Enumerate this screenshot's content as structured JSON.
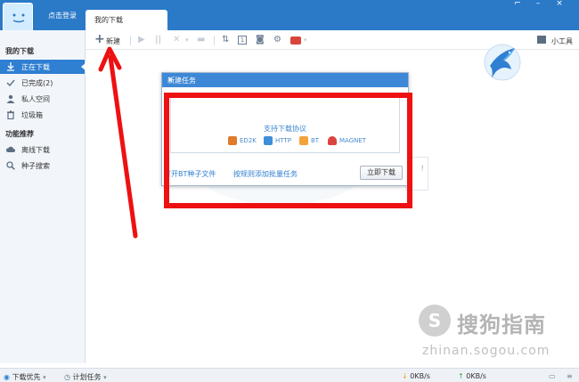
{
  "app": {
    "login_text": "点击登录",
    "tab_label": "我的下载",
    "window_controls": [
      "restore-icon",
      "minimize-icon",
      "close-icon"
    ]
  },
  "sidebar": {
    "section_my_downloads": "我的下载",
    "items": [
      {
        "label": "正在下载",
        "icon": "download-icon",
        "active": true
      },
      {
        "label": "已完成(2)",
        "icon": "check-icon",
        "active": false
      },
      {
        "label": "私人空间",
        "icon": "user-icon",
        "active": false
      },
      {
        "label": "垃圾箱",
        "icon": "trash-icon",
        "active": false
      }
    ],
    "section_features": "功能推荐",
    "feature_items": [
      {
        "label": "离线下载",
        "icon": "cloud-icon"
      },
      {
        "label": "种子搜索",
        "icon": "search-icon"
      }
    ]
  },
  "toolbar": {
    "new_label": "新建",
    "tools_label": "小工具",
    "icons": [
      "play-icon",
      "pause-icon",
      "delete-icon",
      "folder-icon",
      "sort-icon",
      "info-icon",
      "magnet-search-icon",
      "settings-icon",
      "vip-icon"
    ]
  },
  "dialog": {
    "title": "新建任务",
    "protocols_title": "支持下载协议",
    "protocols": [
      {
        "label": "ED2K",
        "icon": "ed2k-icon",
        "color": "#e07b2a"
      },
      {
        "label": "HTTP",
        "icon": "http-icon",
        "color": "#3d8fd8"
      },
      {
        "label": "BT",
        "icon": "bt-icon",
        "color": "#f2a33a"
      },
      {
        "label": "MAGNET",
        "icon": "magnet-icon",
        "color": "#d9453c"
      }
    ],
    "open_bt_link": "打开BT种子文件",
    "batch_link": "按规则添加批量任务",
    "download_now": "立即下载"
  },
  "background_card": {
    "symbol": "!"
  },
  "watermark": {
    "logo_char": "S",
    "text": "搜狗指南",
    "url": "zhinan.sogou.com"
  },
  "statusbar": {
    "download_priority": "下载优先",
    "plan_task": "计划任务",
    "down_speed": "0KB/s",
    "up_speed": "0KB/s"
  },
  "colors": {
    "title_bar": "#2b7ac8",
    "accent": "#2f7fd2",
    "annotation_red": "#ee1111"
  }
}
